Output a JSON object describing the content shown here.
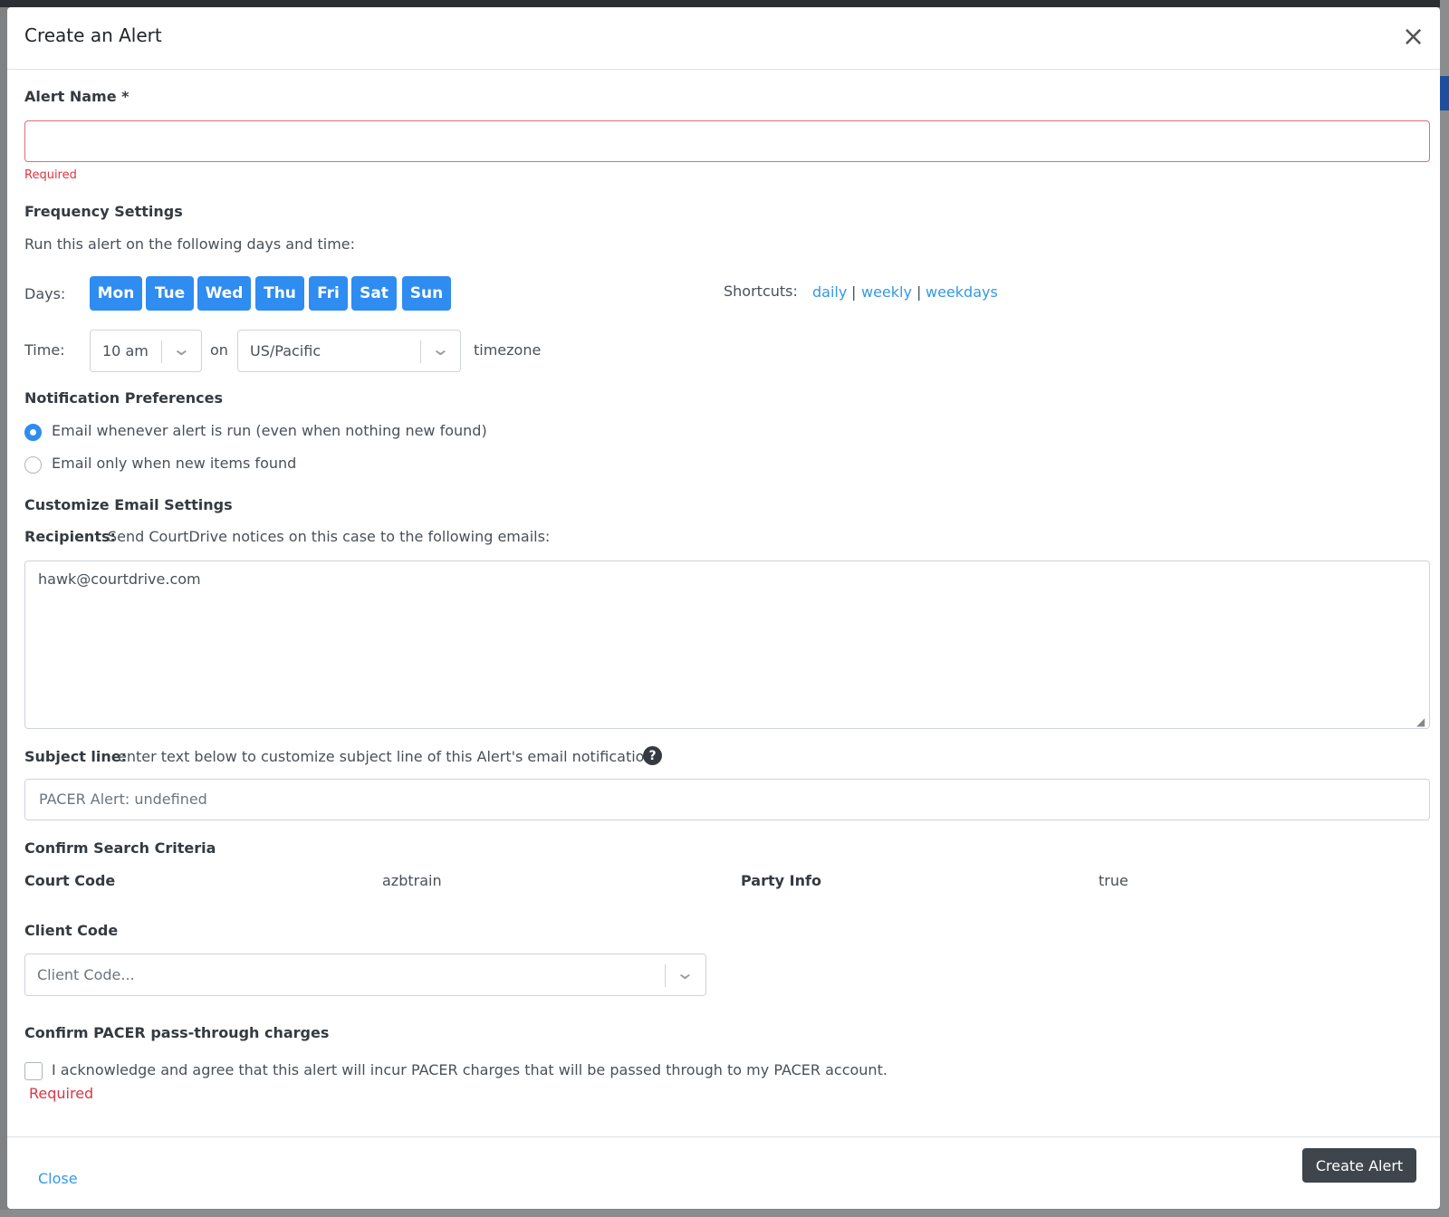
{
  "modal": {
    "title": "Create an Alert",
    "close_icon": "×"
  },
  "alert_name": {
    "label": "Alert Name *",
    "value": "",
    "error": "Required"
  },
  "frequency": {
    "heading": "Frequency Settings",
    "description": "Run this alert on the following days and time:",
    "days_label": "Days:",
    "days": [
      "Mon",
      "Tue",
      "Wed",
      "Thu",
      "Fri",
      "Sat",
      "Sun"
    ],
    "shortcuts_label": "Shortcuts:",
    "shortcuts": [
      "daily",
      "weekly",
      "weekdays"
    ],
    "shortcut_separator": "|",
    "time_label": "Time:",
    "time_value": "10 am",
    "on_label": "on",
    "timezone_value": "US/Pacific",
    "timezone_label": "timezone",
    "active_color": "#2f8cf0"
  },
  "notification": {
    "heading": "Notification Preferences",
    "options": [
      {
        "label": "Email whenever alert is run (even when nothing new found)",
        "selected": true
      },
      {
        "label": "Email only when new items found",
        "selected": false
      }
    ]
  },
  "email": {
    "heading": "Customize Email Settings",
    "recipients_label": "Recipients:",
    "recipients_desc": "Send CourtDrive notices on this case to the following emails:",
    "recipients_value": "hawk@courtdrive.com",
    "subject_label": "Subject line:",
    "subject_desc": "enter text below to customize subject line of this Alert's email notification.",
    "help_icon": "?",
    "subject_placeholder": "PACER Alert: undefined"
  },
  "criteria": {
    "heading": "Confirm Search Criteria",
    "court_code_label": "Court Code",
    "court_code_value": "azbtrain",
    "party_info_label": "Party Info",
    "party_info_value": "true"
  },
  "client_code": {
    "label": "Client Code",
    "placeholder": "Client Code..."
  },
  "pacer": {
    "heading": "Confirm PACER pass-through charges",
    "acknowledge": "I acknowledge and agree that this alert will incur PACER charges that will be passed through to my PACER account.",
    "error": "Required"
  },
  "footer": {
    "close_label": "Close",
    "create_label": "Create Alert"
  }
}
